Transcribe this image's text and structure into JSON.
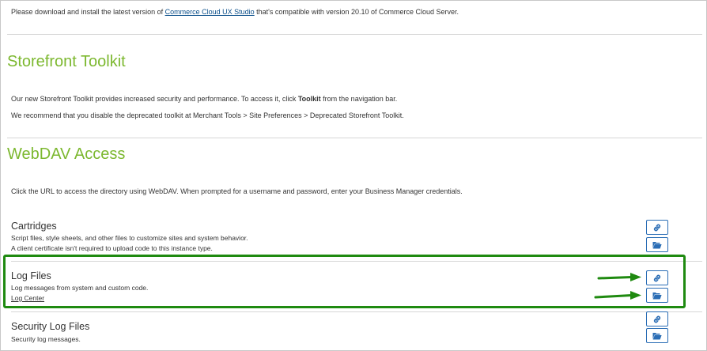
{
  "intro": {
    "prefix": "Please download and install the latest version of ",
    "link": "Commerce Cloud UX Studio",
    "suffix": " that's compatible with version 20.10 of Commerce Cloud Server."
  },
  "toolkit": {
    "title": "Storefront Toolkit",
    "line1_prefix": "Our new Storefront Toolkit provides increased security and performance. To access it, click ",
    "line1_bold": "Toolkit",
    "line1_suffix": " from the navigation bar.",
    "line2": "We recommend that you disable the deprecated toolkit at Merchant Tools > Site Preferences > Deprecated Storefront Toolkit."
  },
  "webdav": {
    "title": "WebDAV Access",
    "description": "Click the URL to access the directory using WebDAV. When prompted for a username and password, enter your Business Manager credentials.",
    "items": [
      {
        "title": "Cartridges",
        "line1": "Script files, style sheets, and other files to customize sites and system behavior.",
        "line2": "A client certificate isn't required to upload code to this instance type."
      },
      {
        "title": "Log Files",
        "line1": "Log messages from system and custom code.",
        "link": "Log Center"
      },
      {
        "title": "Security Log Files",
        "line1": "Security log messages."
      }
    ]
  },
  "icons": {
    "link": "link-icon",
    "folder": "folder-open-icon"
  },
  "colors": {
    "heading": "#7cb82f",
    "button_border": "#2a6db5",
    "icon": "#2a6db5",
    "highlight": "#1f8a10",
    "link": "#0b4f8a"
  }
}
